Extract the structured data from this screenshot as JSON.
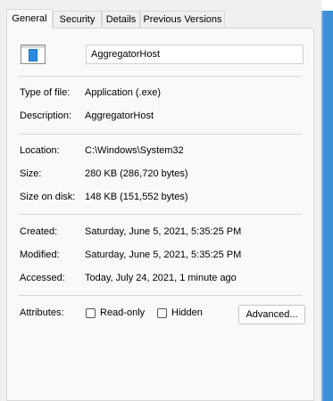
{
  "tabs": [
    {
      "label": "General",
      "active": true
    },
    {
      "label": "Security"
    },
    {
      "label": "Details"
    },
    {
      "label": "Previous Versions"
    }
  ],
  "file": {
    "name": "AggregatorHost",
    "icon": "application-window-icon"
  },
  "info": {
    "type_label": "Type of file:",
    "type_value": "Application (.exe)",
    "description_label": "Description:",
    "description_value": "AggregatorHost",
    "location_label": "Location:",
    "location_value": "C:\\Windows\\System32",
    "size_label": "Size:",
    "size_value": "280 KB (286,720 bytes)",
    "size_on_disk_label": "Size on disk:",
    "size_on_disk_value": "148 KB (151,552 bytes)",
    "created_label": "Created:",
    "created_value": "Saturday, June 5, 2021, 5:35:25 PM",
    "modified_label": "Modified:",
    "modified_value": "Saturday, June 5, 2021, 5:35:25 PM",
    "accessed_label": "Accessed:",
    "accessed_value": "Today, July 24, 2021, 1 minute ago"
  },
  "attributes": {
    "label": "Attributes:",
    "read_only": {
      "label": "Read-only",
      "checked": false
    },
    "hidden": {
      "label": "Hidden",
      "checked": false
    },
    "advanced_label": "Advanced..."
  },
  "colors": {
    "accent": "#0f6cbd",
    "icon_blue": "#1a73c9",
    "window_edge": "#3f8fd8"
  }
}
